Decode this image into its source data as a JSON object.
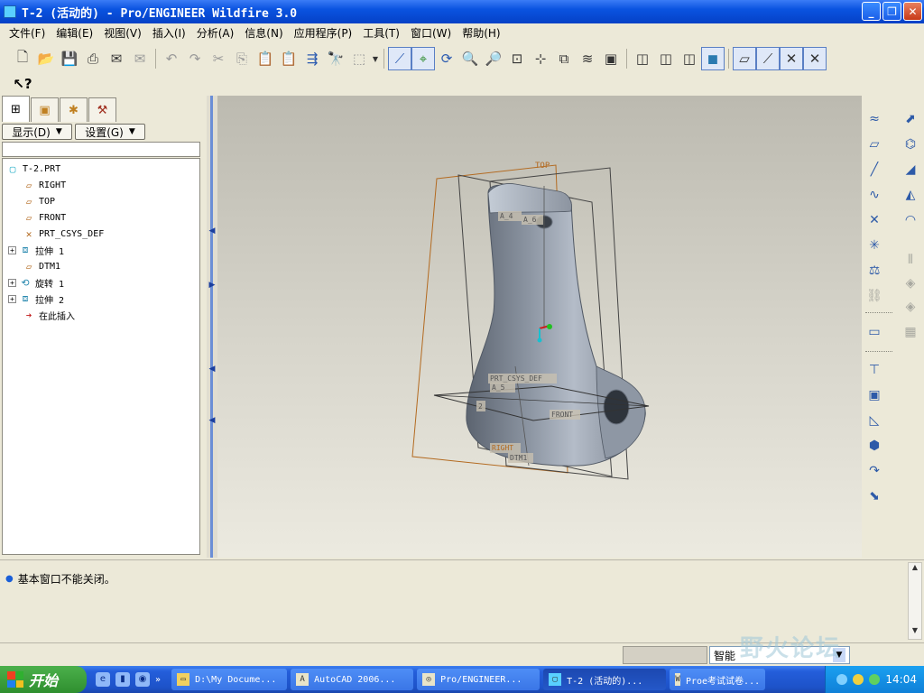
{
  "window": {
    "title": "T-2 (活动的) - Pro/ENGINEER Wildfire 3.0"
  },
  "menu": [
    "文件(F)",
    "编辑(E)",
    "视图(V)",
    "插入(I)",
    "分析(A)",
    "信息(N)",
    "应用程序(P)",
    "工具(T)",
    "窗口(W)",
    "帮助(H)"
  ],
  "panel": {
    "show_button": "显示(D)",
    "settings_button": "设置(G)"
  },
  "tree": {
    "items": [
      {
        "label": "T-2.PRT",
        "icon": "part-icon"
      },
      {
        "label": "RIGHT",
        "icon": "datum-plane-icon"
      },
      {
        "label": "TOP",
        "icon": "datum-plane-icon"
      },
      {
        "label": "FRONT",
        "icon": "datum-plane-icon"
      },
      {
        "label": "PRT_CSYS_DEF",
        "icon": "csys-icon"
      },
      {
        "label": "拉伸 1",
        "icon": "extrude-icon"
      },
      {
        "label": "DTM1",
        "icon": "datum-plane-icon"
      },
      {
        "label": "旋转 1",
        "icon": "revolve-icon"
      },
      {
        "label": "拉伸 2",
        "icon": "extrude-icon"
      },
      {
        "label": "在此插入",
        "icon": "insert-here-arrow-icon"
      }
    ]
  },
  "model_labels": {
    "top": "TOP",
    "front": "FRONT",
    "right": "RIGHT",
    "dtm1": "DTM1",
    "csys": "PRT_CSYS_DEF",
    "a4": "A_4",
    "a6": "A_6",
    "a5": "A_5",
    "a2": "2"
  },
  "message": {
    "text": "基本窗口不能关闭。"
  },
  "status": {
    "filter": "智能"
  },
  "taskbar": {
    "start": "开始",
    "tasks": [
      "D:\\My Docume...",
      "AutoCAD 2006...",
      "Pro/ENGINEER...",
      "T-2 (活动的)...",
      "Proe考试试卷..."
    ],
    "clock": "14:04"
  },
  "watermark": "野火论坛",
  "colors": {
    "titlebar": "#0a53e0",
    "model": "#9aa2ae",
    "datum_plane": "#b36a20",
    "tray": "#0f80d8"
  }
}
